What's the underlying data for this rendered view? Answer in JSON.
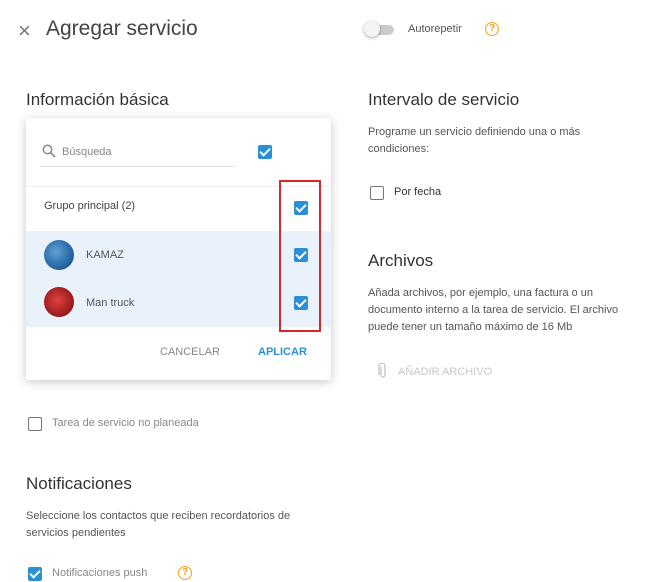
{
  "header": {
    "close_symbol": "×",
    "title": "Agregar servicio",
    "autorepeat_label": "Autorepetir",
    "autorepeat_on": false
  },
  "basic_info": {
    "heading": "Información básica",
    "search_placeholder": "Búsqueda",
    "group_label": "Grupo principal (2)",
    "units": [
      {
        "name": "KAMAZ",
        "checked": true
      },
      {
        "name": "Man truck",
        "checked": true
      }
    ],
    "cancel_label": "CANCELAR",
    "apply_label": "APLICAR",
    "unplanned_label": "Tarea de servicio no planeada"
  },
  "notifications": {
    "heading": "Notificaciones",
    "description": "Seleccione los contactos que reciben recordatorios de servicios pendientes",
    "push_label": "Notificaciones push",
    "push_checked": true
  },
  "service_interval": {
    "heading": "Intervalo de servicio",
    "description": "Programe un servicio definiendo una o más condiciones:",
    "by_date_label": "Por fecha"
  },
  "files": {
    "heading": "Archivos",
    "description": "Añada archivos, por ejemplo, una factura o un documento interno a la tarea de servicio. El archivo puede tener un tamaño máximo de 16 Mb",
    "add_file_label": "AÑADIR ARCHIVO"
  },
  "colors": {
    "accent": "#2b8fd6",
    "help": "#f0a21a",
    "highlight_border": "#d9252b"
  }
}
